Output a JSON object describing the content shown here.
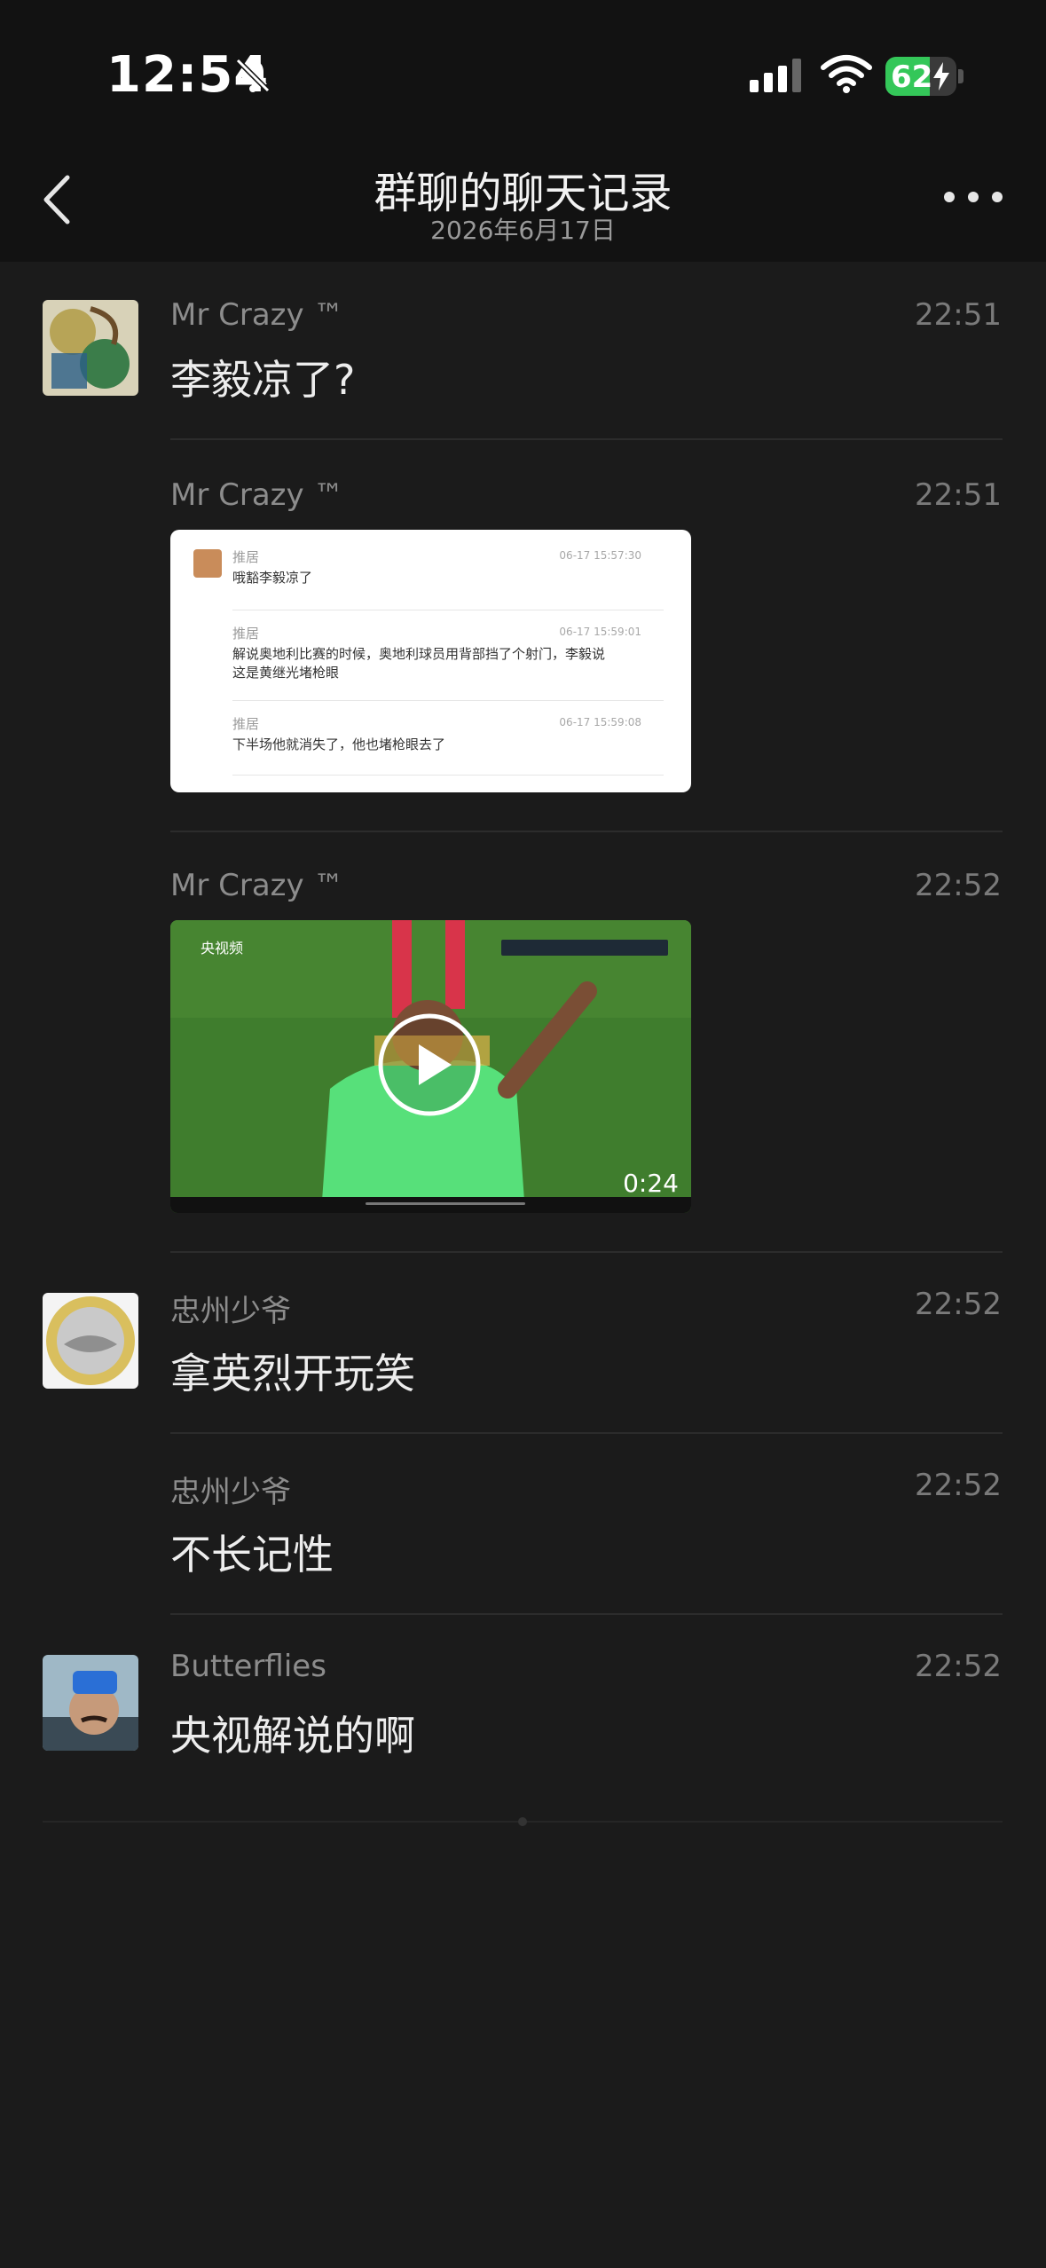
{
  "status_bar": {
    "time": "12:54",
    "battery": "62",
    "battery_level": 62,
    "icons": [
      "bell-slash-icon",
      "cellular-signal-icon",
      "wifi-icon",
      "battery-charging-icon"
    ]
  },
  "nav": {
    "title": "群聊的聊天记录",
    "subtitle": "2026年6月17日",
    "icons": [
      "chevron-left-icon",
      "more-icon"
    ]
  },
  "messages": [
    {
      "sender": "Mr Crazy ™",
      "time": "22:51",
      "text": "李毅凉了?",
      "type": "text"
    },
    {
      "sender": "Mr Crazy ™",
      "time": "22:51",
      "type": "forwarded-chat"
    },
    {
      "sender": "Mr Crazy ™",
      "time": "22:52",
      "type": "video"
    },
    {
      "sender": "忠州少爷",
      "time": "22:52",
      "text": "拿英烈开玩笑",
      "type": "text"
    },
    {
      "sender": "忠州少爷",
      "time": "22:52",
      "text": "不长记性",
      "type": "text"
    },
    {
      "sender": "Butterflies",
      "time": "22:52",
      "text": "央视解说的啊",
      "type": "text"
    }
  ],
  "forwarded_card": {
    "entries": [
      {
        "name": "推居",
        "time": "06-17 15:57:30",
        "text": "哦豁李毅凉了"
      },
      {
        "name": "推居",
        "time": "06-17 15:59:01",
        "text": "解说奥地利比赛的时候，奥地利球员用背部挡了个射门，李毅说这是黄继光堵枪眼"
      },
      {
        "name": "推居",
        "time": "06-17 15:59:08",
        "text": "下半场他就消失了，他也堵枪眼去了"
      }
    ]
  },
  "video": {
    "duration": "0:24",
    "logo": "央视频"
  },
  "colors": {
    "background": "#1b1b1b",
    "bar_background": "#121212",
    "battery_green": "#34c759"
  }
}
